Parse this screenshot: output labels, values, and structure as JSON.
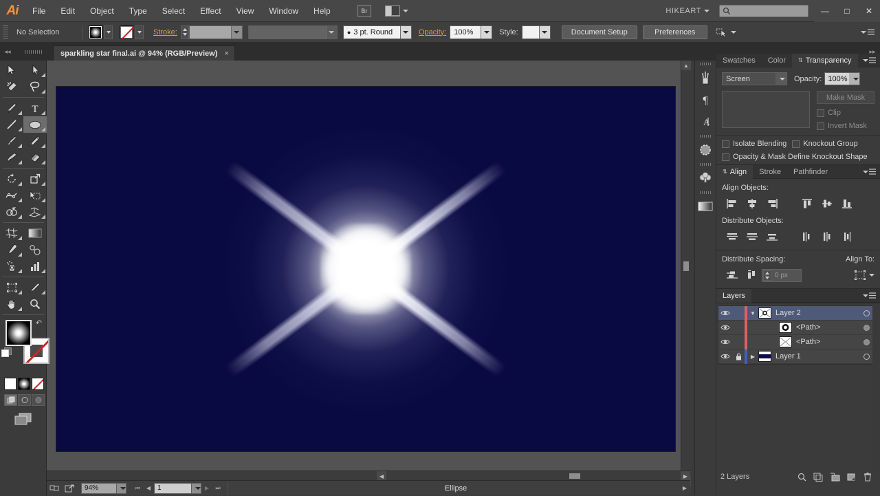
{
  "app": {
    "logo": "Ai",
    "user": "HIKEART",
    "search_placeholder": ""
  },
  "menu": {
    "items": [
      "File",
      "Edit",
      "Object",
      "Type",
      "Select",
      "Effect",
      "View",
      "Window",
      "Help"
    ],
    "bridge_label": "Br"
  },
  "window_controls": {
    "minimize": "—",
    "maximize": "□",
    "close": "✕"
  },
  "control_bar": {
    "selection_status": "No Selection",
    "stroke_label": "Stroke:",
    "stroke_weight": "",
    "stroke_profile": "",
    "brush_value": "3 pt. Round",
    "opacity_label": "Opacity:",
    "opacity_value": "100%",
    "style_label": "Style:",
    "document_setup": "Document Setup",
    "preferences": "Preferences"
  },
  "document": {
    "tab_title": "sparkling star final.ai @ 94% (RGB/Preview)",
    "close_glyph": "×",
    "artboard_bg": "#0a0a42"
  },
  "status_bar": {
    "zoom": "94%",
    "page": "1",
    "tool_status": "Ellipse"
  },
  "toolbar": {
    "tools": [
      "selection-tool",
      "direct-selection-tool",
      "magic-wand-tool",
      "lasso-tool",
      "pen-tool",
      "type-tool",
      "line-segment-tool",
      "ellipse-tool",
      "paintbrush-tool",
      "pencil-tool",
      "blob-brush-tool",
      "eraser-tool",
      "rotate-tool",
      "scale-tool",
      "width-tool",
      "free-transform-tool",
      "shape-builder-tool",
      "perspective-grid-tool",
      "mesh-tool",
      "gradient-tool",
      "eyedropper-tool",
      "blend-tool",
      "symbol-sprayer-tool",
      "column-graph-tool",
      "artboard-tool",
      "slice-tool",
      "hand-tool",
      "zoom-tool"
    ],
    "selected_tool": "ellipse-tool",
    "fill_stroke": {
      "fill": "gradient-glow",
      "stroke": "none",
      "swap": "swap-fill-stroke-icon",
      "default": "default-fill-stroke-icon"
    },
    "color_modes": [
      "color-mode",
      "gradient-mode",
      "none-mode"
    ],
    "draw_modes": [
      "draw-normal",
      "draw-behind",
      "draw-inside"
    ],
    "screen_mode": "change-screen-mode"
  },
  "icon_rail": [
    "brushes-icon",
    "paragraph-icon",
    "character-icon",
    "symbols-icon",
    "graphic-styles-icon",
    "gradient-icon"
  ],
  "transparency_panel": {
    "tabs": [
      "Swatches",
      "Color",
      "Transparency"
    ],
    "active_tab": "Transparency",
    "blend_mode": "Screen",
    "opacity_label": "Opacity:",
    "opacity_value": "100%",
    "make_mask": "Make Mask",
    "clip": "Clip",
    "invert_mask": "Invert Mask",
    "isolate_blending": "Isolate Blending",
    "knockout_group": "Knockout Group",
    "opacity_mask_define": "Opacity & Mask Define Knockout Shape"
  },
  "align_panel": {
    "tabs": [
      "Align",
      "Stroke",
      "Pathfinder"
    ],
    "active_tab": "Align",
    "align_objects_label": "Align Objects:",
    "distribute_objects_label": "Distribute Objects:",
    "distribute_spacing_label": "Distribute Spacing:",
    "align_to_label": "Align To:",
    "spacing_value": "0 px",
    "align_buttons": [
      "align-left-edge",
      "align-horizontal-center",
      "align-right-edge",
      "align-top-edge",
      "align-vertical-center",
      "align-bottom-edge"
    ],
    "distribute_buttons": [
      "distribute-top-edge",
      "distribute-vertical-center",
      "distribute-bottom-edge",
      "distribute-left-edge",
      "distribute-horizontal-center",
      "distribute-right-edge"
    ],
    "spacing_buttons": [
      "distribute-vertical-space",
      "distribute-horizontal-space"
    ]
  },
  "layers_panel": {
    "tab": "Layers",
    "rows": [
      {
        "name": "Layer 2",
        "type": "layer",
        "selected": true,
        "locked": false,
        "expanded": true,
        "color": "#e06060",
        "thumb": "glow-thumb",
        "indent": 0,
        "target_filled": false
      },
      {
        "name": "<Path>",
        "type": "path",
        "selected": false,
        "locked": false,
        "expanded": false,
        "color": "#e06060",
        "thumb": "glow-thumb",
        "indent": 1,
        "target_filled": true
      },
      {
        "name": "<Path>",
        "type": "path",
        "selected": false,
        "locked": false,
        "expanded": false,
        "color": "#e06060",
        "thumb": "cross-thumb",
        "indent": 1,
        "target_filled": true
      },
      {
        "name": "Layer 1",
        "type": "layer",
        "selected": false,
        "locked": true,
        "expanded": false,
        "color": "#4060c0",
        "thumb": "navy-thumb",
        "indent": 0,
        "target_filled": false
      }
    ],
    "status": "2 Layers",
    "status_icons": [
      "locate-object-icon",
      "make-clipping-mask-icon",
      "create-sublayer-icon",
      "create-new-layer-icon",
      "delete-selection-icon"
    ]
  }
}
